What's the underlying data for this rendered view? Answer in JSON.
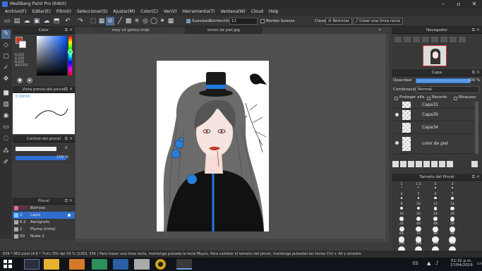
{
  "window": {
    "title": "MediBang Paint Pro (64bit)"
  },
  "menu": [
    "Archivo(F)",
    "Editar(E)",
    "Filtro(I)",
    "Seleccionar(S)",
    "Ajustar(M)",
    "Color(C)",
    "Ver(V)",
    "Herramienta(T)",
    "Ventana(W)",
    "Cloud",
    "Help"
  ],
  "toolbar": {
    "suavizado": "Suavizado",
    "correccion": "Corrección",
    "correccion_value": "11",
    "bordes_suaves": "Bordes Suaves",
    "clave": "Clave",
    "reiniciar": "Reiniciar",
    "crear_linea": "Crear una línea recta"
  },
  "tabs": [
    "moy vil gotico.mdp",
    "tonos de piel.jpg"
  ],
  "color_panel": {
    "title": "Color",
    "r": "R:255",
    "g": "G:255",
    "b": "B:255",
    "hex": "#FFFFFF"
  },
  "brush_preview": {
    "title": "Vista previa del pincel",
    "size": "0.10mm"
  },
  "brush_control": {
    "title": "Control del pincel",
    "size_value": "2",
    "opacity_value": "100 %"
  },
  "brush_panel": {
    "title": "Pincel",
    "items": [
      {
        "num": "150",
        "name": "Borroso"
      },
      {
        "num": "2",
        "name": "Lápiz"
      },
      {
        "num": "6.2",
        "name": "Aerógrafo"
      },
      {
        "num": "2",
        "name": "Pluma (tinta)"
      },
      {
        "num": "50",
        "name": "Nube 2"
      }
    ]
  },
  "navigator": {
    "title": "Navegador"
  },
  "layer_panel": {
    "title": "Capa",
    "opacity_label": "Opacidad",
    "opacity_value": "100 %",
    "blend_label": "Combinación",
    "blend_value": "Normal",
    "proteger_alfa": "Proteger alfa",
    "recorte": "Recorte",
    "bloquear": "Bloquear",
    "layers": [
      "Capa31",
      "Capa30",
      "Capa34",
      "color de piel"
    ]
  },
  "brush_size_panel": {
    "title": "Tamaño del Pincel",
    "rows": [
      [
        "1",
        "1.5",
        "2",
        "3"
      ],
      [
        "4",
        "5",
        "6",
        "7"
      ],
      [
        "8",
        "10",
        "12",
        "14"
      ],
      [
        "16",
        "20",
        "24",
        "28"
      ],
      [
        "32",
        "40",
        "48",
        "56"
      ],
      [
        "64",
        "72",
        "80",
        "96"
      ],
      [
        "112",
        "128",
        "160",
        "192"
      ]
    ]
  },
  "status": {
    "text": "639 * 963 pixel  (4.6 * 7cm)  350 dpi  50 %  (1263, 334 )  Para trazar una línea recta, mantenga pulsada la tecla Mayús. Para cambiar el tamaño del pincel, mantenga pulsadas las teclas Ctrl + Alt y arrastre"
  },
  "taskbar": {
    "lang": "ES",
    "time": "01:32 p.m.",
    "date": "27/04/2019"
  },
  "colors": {
    "accent": "#4f6e94",
    "hat_band": "#1f7ad8",
    "rose": "#2a7fd4",
    "lips": "#c0392b"
  }
}
